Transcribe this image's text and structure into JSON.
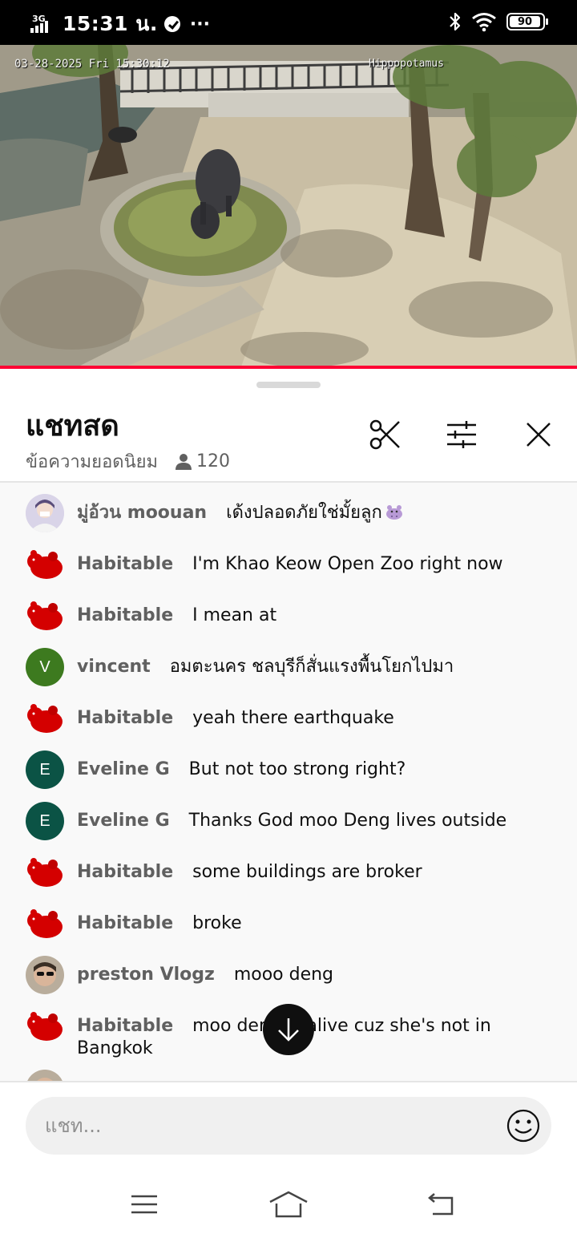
{
  "status_bar": {
    "network": "3G",
    "time": "15:31 น.",
    "more": "···",
    "battery": "90"
  },
  "video": {
    "timestamp": "03-28-2025 Fri 15:30:12",
    "camera_label": "Hippopotamus"
  },
  "chat": {
    "title": "แชทสด",
    "mode": "ข้อความยอดนิยม",
    "viewer_count": "120",
    "input_placeholder": "แชท...",
    "messages": [
      {
        "author": "มู่อ้วน moouan",
        "text": "เด้งปลอดภัยใช่มั้ยลูก",
        "avatar": "photo-user"
      },
      {
        "author": "Habitable",
        "text": "I'm Khao Keow Open Zoo right now",
        "avatar": "red-hippo"
      },
      {
        "author": "Habitable",
        "text": "I mean at",
        "avatar": "red-hippo"
      },
      {
        "author": "vincent",
        "text": "อมตะนคร ชลบุรีก็สั่นแรงพื้นโยกไปมา",
        "avatar": "V"
      },
      {
        "author": "Habitable",
        "text": "yeah there earthquake",
        "avatar": "red-hippo"
      },
      {
        "author": "Eveline G",
        "text": "But not too strong right?",
        "avatar": "E"
      },
      {
        "author": "Eveline G",
        "text": "Thanks God moo Deng lives outside",
        "avatar": "E"
      },
      {
        "author": "Habitable",
        "text": "some buildings are broker",
        "avatar": "red-hippo"
      },
      {
        "author": "Habitable",
        "text": "broke",
        "avatar": "red-hippo"
      },
      {
        "author": "preston Vlogz",
        "text": "mooo deng",
        "avatar": "photo-user"
      },
      {
        "author": "Habitable",
        "text": "moo deng is alive cuz she's not in Bangkok",
        "avatar": "red-hippo"
      }
    ]
  },
  "colors": {
    "progress": "#ff0033",
    "vincent_avatar": "#3d7a1f",
    "eveline_avatar": "#0b5345",
    "hippo_avatar": "#d40000"
  }
}
